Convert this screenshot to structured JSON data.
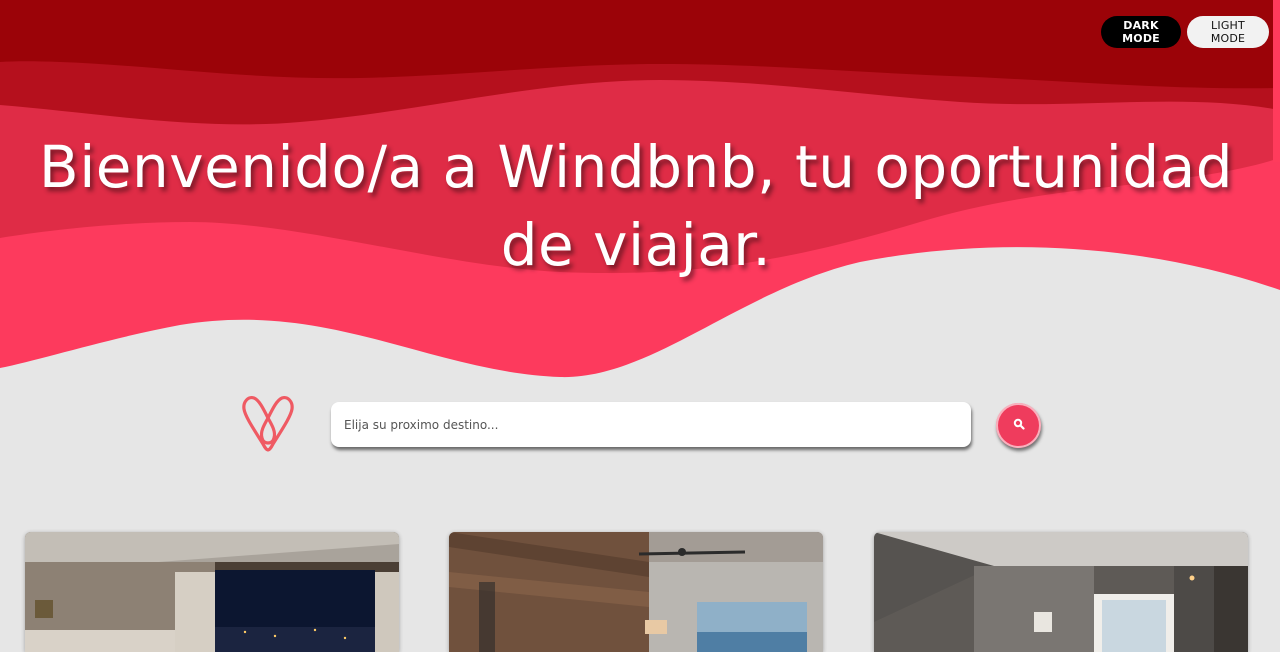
{
  "header": {
    "dark_mode_label": "DARK MODE",
    "light_mode_label": "LIGHT MODE",
    "title": "Bienvenido/a a Windbnb, tu oportunidad de viajar."
  },
  "search": {
    "placeholder": "Elija su proximo destino..."
  },
  "listings": [
    {
      "image": "hotel-room-city-night-photo"
    },
    {
      "image": "room-wood-wall-ceiling-fan-photo"
    },
    {
      "image": "modern-gray-bedroom-photo"
    }
  ],
  "colors": {
    "wave_dark": "#9b0308",
    "wave_mid": "#b5101d",
    "wave_light": "#df2c46",
    "wave_bright": "#fd3a5d",
    "background": "#e6e6e6",
    "accent": "#ef3c5d"
  }
}
